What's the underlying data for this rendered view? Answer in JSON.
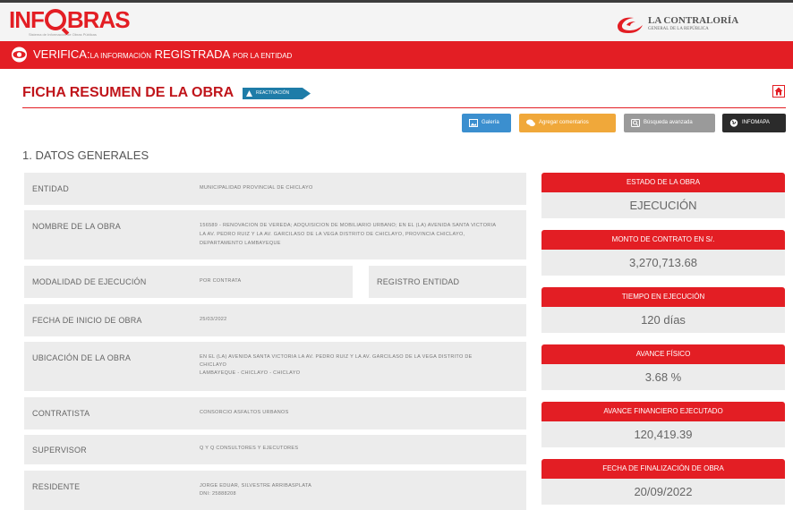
{
  "header": {
    "logo_text_left": "INF",
    "logo_text_right": "BRAS",
    "logo_subtitle": "Sistema de Información de Obras Públicas",
    "contraloria_title": "LA CONTRALORÍA",
    "contraloria_subtitle": "GENERAL DE LA REPÚBLICA"
  },
  "banner": {
    "big1": "VERIFICA:",
    "small1": "LA INFORMACIÓN",
    "big2": " REGISTRADA ",
    "small2": "POR LA ENTIDAD"
  },
  "page": {
    "title": "FICHA RESUMEN DE LA OBRA",
    "status_tag": "REACTIVACIÓN"
  },
  "actions": {
    "galeria": "Galería",
    "comentarios": "Agregar comentarios",
    "busqueda": "Búsqueda avanzada",
    "infomapa": "INFOMAPA"
  },
  "section_title": "1. DATOS GENERALES",
  "datos": {
    "entidad_label": "ENTIDAD",
    "entidad_value": "MUNICIPALIDAD PROVINCIAL DE CHICLAYO",
    "nombre_label": "NOMBRE DE LA OBRA",
    "nombre_line1": "156589 - RENOVACION DE VEREDA; ADQUISICION DE MOBILIARIO URBANO; EN EL (LA) AVENIDA SANTA VICTORIA",
    "nombre_line2": "LA AV. PEDRO RUIZ Y LA AV. GARCILASO DE LA VEGA DISTRITO DE CHICLAYO, PROVINCIA CHICLAYO,",
    "nombre_line3": "DEPARTAMENTO LAMBAYEQUE",
    "modalidad_label": "MODALIDAD DE EJECUCIÓN",
    "modalidad_value": "POR CONTRATA",
    "registro_label": "REGISTRO ENTIDAD",
    "fecha_inicio_label": "FECHA DE INICIO DE OBRA",
    "fecha_inicio_value": "25/03/2022",
    "ubicacion_label": "UBICACIÓN DE LA OBRA",
    "ubicacion_line1": "EN EL (LA) AVENIDA SANTA VICTORIA LA AV. PEDRO RUIZ Y LA AV. GARCILASO DE LA VEGA DISTRITO DE",
    "ubicacion_line2": "CHICLAYO",
    "ubicacion_line3": "LAMBAYEQUE - CHICLAYO - CHICLAYO",
    "contratista_label": "CONTRATISTA",
    "contratista_value": "CONSORCIO ASFALTOS URBANOS",
    "supervisor_label": "SUPERVISOR",
    "supervisor_value": "Q Y Q CONSULTORES Y EJECUTORES",
    "residente_label": "RESIDENTE",
    "residente_line1": "JORGE EDUAR, SILVESTRE ARRIBASPLATA",
    "residente_line2": "DNI: 25888208"
  },
  "status": {
    "estado_label": "ESTADO DE LA OBRA",
    "estado_value": "EJECUCIÓN",
    "monto_label": "MONTO DE CONTRATO EN S/.",
    "monto_value": "3,270,713.68",
    "tiempo_label": "TIEMPO EN EJECUCIÓN",
    "tiempo_value": "120 días",
    "avance_fisico_label": "AVANCE FÍSICO",
    "avance_fisico_value": "3.68 %",
    "avance_fin_label": "AVANCE FINANCIERO EJECUTADO",
    "avance_fin_value": "120,419.39",
    "fecha_fin_label": "FECHA DE FINALIZACIÓN DE OBRA",
    "fecha_fin_value": "20/09/2022"
  },
  "colors": {
    "brand_red": "#e31e24",
    "title_red": "#c0151b",
    "row_bg": "#ececec",
    "galeria_blue": "#3b8fcf",
    "comentarios_orange": "#f0a83a",
    "busqueda_gray": "#9a9a9a",
    "infomapa_dark": "#2b2b2b",
    "tag_blue": "#1e7ca8"
  },
  "icons": [
    "eye-icon",
    "home-icon",
    "image-icon",
    "comments-icon",
    "search-icon",
    "globe-icon",
    "worker-icon"
  ]
}
